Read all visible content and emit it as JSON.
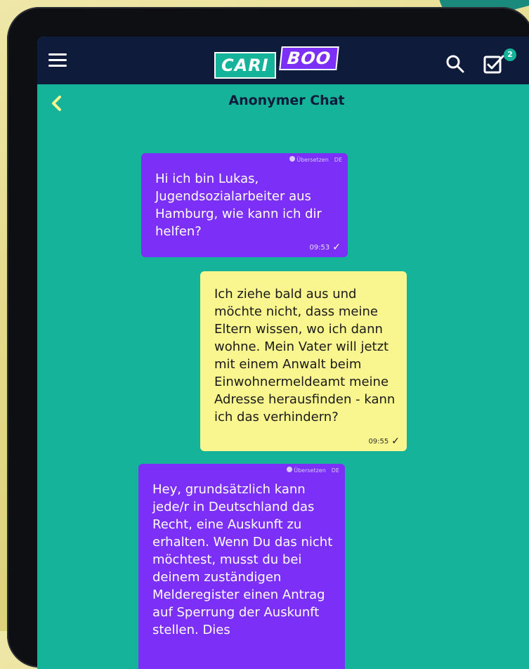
{
  "header": {
    "logo_part1": "CARI",
    "logo_part2": "BOO",
    "inbox_badge": "2"
  },
  "chat": {
    "title": "Anonymer Chat",
    "messages": [
      {
        "direction": "incoming",
        "translate_label": "Übersetzen",
        "lang": "DE",
        "text": "Hi ich bin Lukas, Jugendsozialarbeiter aus Hamburg, wie kann ich dir helfen?",
        "time": "09:53"
      },
      {
        "direction": "outgoing",
        "text": "Ich ziehe bald aus und möchte nicht, dass meine Eltern wissen, wo ich dann wohne. Mein Vater will jetzt mit einem Anwalt beim Einwohnermeldeamt meine Adresse herausfinden - kann ich das verhindern?",
        "time": "09:55"
      },
      {
        "direction": "incoming",
        "translate_label": "Übersetzen",
        "lang": "DE",
        "text": "Hey, grundsätzlich kann jede/r in Deutschland das Recht, eine Auskunft zu erhalten. Wenn Du das nicht möchtest, musst du bei deinem zuständigen Melderegister einen Antrag auf Sperrung der Auskunft stellen. Dies"
      }
    ]
  },
  "colors": {
    "screen_bg": "#14b39a",
    "topbar": "#0f1b3a",
    "incoming_bubble": "#7b2ff7",
    "outgoing_bubble": "#f9f58f",
    "accent_back": "#f9f58f"
  },
  "icons": [
    "hamburger-menu-icon",
    "search-icon",
    "inbox-check-icon",
    "back-chevron-icon",
    "translate-globe-icon",
    "check-icon"
  ]
}
